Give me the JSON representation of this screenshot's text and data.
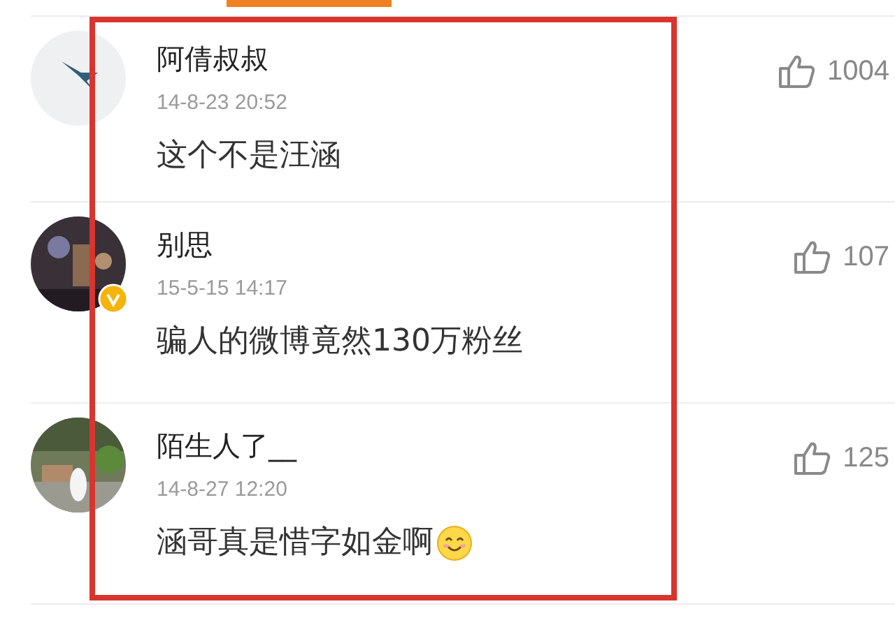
{
  "comments": [
    {
      "name": "阿倩叔叔",
      "time": "14-8-23 20:52",
      "text": "这个不是汪涵",
      "likes": "1004",
      "verified": false,
      "smiley": false
    },
    {
      "name": "别思",
      "time": "15-5-15 14:17",
      "text": "骗人的微博竟然130万粉丝",
      "likes": "107",
      "verified": true,
      "smiley": false
    },
    {
      "name": "陌生人了__",
      "time": "14-8-27 12:20",
      "text": "涵哥真是惜字如金啊",
      "likes": "125",
      "verified": false,
      "smiley": true
    }
  ]
}
